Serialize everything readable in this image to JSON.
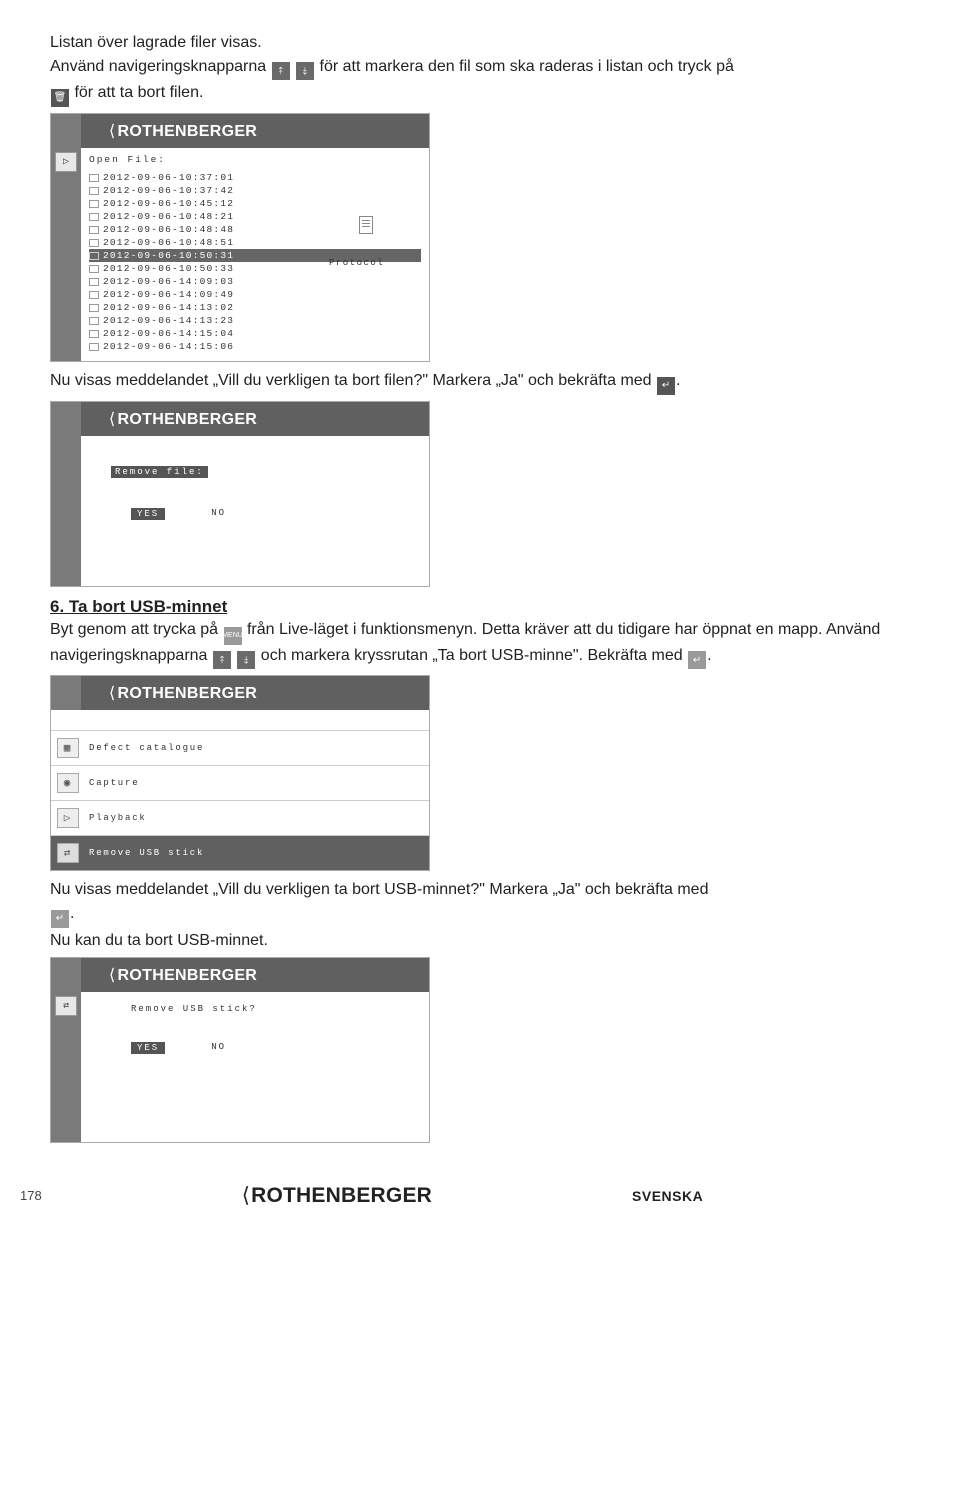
{
  "intro": {
    "l1": "Listan över lagrade filer visas.",
    "l2a": "Använd navigeringsknapparna ",
    "l2b": " för att markera den fil som ska raderas i listan och tryck på",
    "l3a": " för att ta bort filen."
  },
  "screenshot1": {
    "brand": "ROTHENBERGER",
    "title": "Open File:",
    "files": [
      "2012-09-06-10:37:01",
      "2012-09-06-10:37:42",
      "2012-09-06-10:45:12",
      "2012-09-06-10:48:21",
      "2012-09-06-10:48:48",
      "2012-09-06-10:48:51",
      "2012-09-06-10:50:31",
      "2012-09-06-10:50:33",
      "2012-09-06-14:09:03",
      "2012-09-06-14:09:49",
      "2012-09-06-14:13:02",
      "2012-09-06-14:13:23",
      "2012-09-06-14:15:04",
      "2012-09-06-14:15:06"
    ],
    "selected_index": 6,
    "protocol": "Protocol"
  },
  "mid1": "Nu visas meddelandet „Vill du verkligen ta bort filen?\" Markera „Ja\" och bekräfta med ",
  "mid1_end": ".",
  "screenshot2": {
    "brand": "ROTHENBERGER",
    "title": "Remove file:",
    "yes": "YES",
    "no": "NO"
  },
  "section6": {
    "heading": "6. Ta bort USB-minnet",
    "p1a": "Byt genom att trycka på ",
    "p1b": " från Live-läget i funktionsmenyn. Detta kräver att du tidigare har öppnat en mapp. Använd navigeringsknapparna ",
    "p1c": " och markera kryssrutan „Ta bort USB-minne\". Bekräfta med ",
    "p1d": "."
  },
  "screenshot3": {
    "brand": "ROTHENBERGER",
    "items": [
      {
        "label": "Defect catalogue",
        "icon": "▦"
      },
      {
        "label": "Capture",
        "icon": "◉"
      },
      {
        "label": "Playback",
        "icon": "▷"
      },
      {
        "label": "Remove USB stick",
        "icon": "⇄"
      }
    ],
    "selected_index": 3
  },
  "mid2": "Nu visas meddelandet „Vill du verkligen ta bort USB-minnet?\" Markera „Ja\" och bekräfta med",
  "mid2_end": ".",
  "mid3": "Nu kan du ta bort USB-minnet.",
  "screenshot4": {
    "brand": "ROTHENBERGER",
    "title": "Remove USB stick?",
    "yes": "YES",
    "no": "NO"
  },
  "footer": {
    "page": "178",
    "brand": "ROTHENBERGER",
    "lang": "SVENSKA"
  }
}
